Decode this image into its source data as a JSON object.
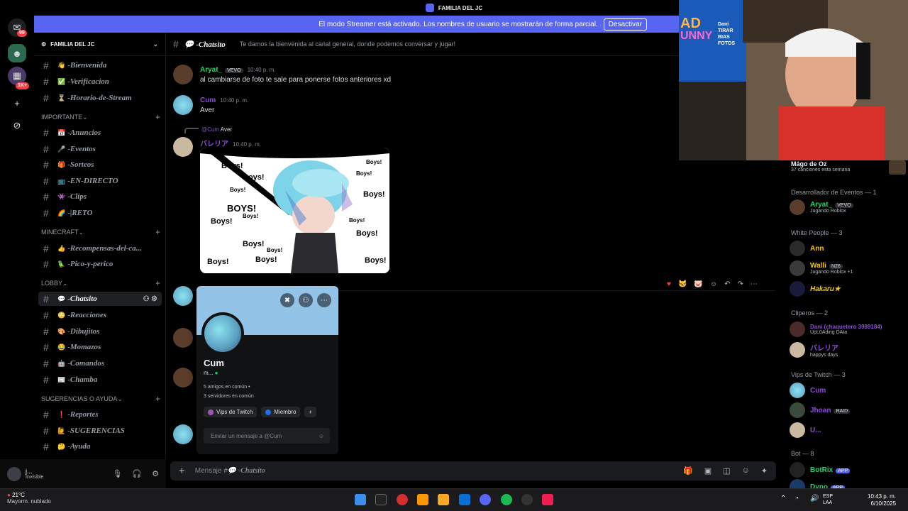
{
  "window": {
    "title": "FAMILIA DEL JC"
  },
  "rail": {
    "badge_top": "99",
    "badge_mid": "1K+"
  },
  "streamer_banner": {
    "text": "El modo Streamer está activado. Los nombres de usuario se mostrarán de forma parcial.",
    "button": "Desactivar"
  },
  "server": {
    "name": "FAMILIA DEL JC"
  },
  "channels": {
    "top": [
      {
        "emoji": "👋",
        "name": "-Bienvenida"
      },
      {
        "emoji": "✅",
        "name": "-Verificacion"
      },
      {
        "emoji": "⏳",
        "name": "-Horario-de-Stream"
      }
    ],
    "cat_importante": "IMPORTANTE",
    "importante": [
      {
        "emoji": "📅",
        "name": "-Anuncios"
      },
      {
        "emoji": "🎤",
        "name": "-Eventos"
      },
      {
        "emoji": "🎁",
        "name": "-Sorteos"
      },
      {
        "emoji": "📺",
        "name": "-EN-DIRECTO"
      },
      {
        "emoji": "👾",
        "name": "-Clips"
      },
      {
        "emoji": "🌈",
        "name": "-|RETO"
      }
    ],
    "cat_minecraft": "MINECRAFT",
    "minecraft": [
      {
        "emoji": "👍",
        "name": "-Recompensas-del-ca..."
      },
      {
        "emoji": "🦜",
        "name": "-Pico-y-perico"
      }
    ],
    "cat_lobby": "LOBBY",
    "lobby": [
      {
        "emoji": "💬",
        "name": "-Chatsito"
      },
      {
        "emoji": "😳",
        "name": "-Reacciones"
      },
      {
        "emoji": "🎨",
        "name": "-Dibujitos"
      },
      {
        "emoji": "😂",
        "name": "-Momazos"
      },
      {
        "emoji": "🤖",
        "name": "-Comandos"
      },
      {
        "emoji": "📰",
        "name": "-Chamba"
      }
    ],
    "cat_sugerencias": "SUGERENCIAS O AYUDA",
    "sugerencias": [
      {
        "emoji": "❗",
        "name": "-Reportes"
      },
      {
        "emoji": "🙋",
        "name": "-SUGERENCIAS"
      },
      {
        "emoji": "🤔",
        "name": "-Ayuda"
      }
    ]
  },
  "user": {
    "name": "j...",
    "status": "Invisible"
  },
  "chat_header": {
    "channel": "💬 -Chatsito",
    "topic": "Te damos la bienvenida al canal general, donde podemos conversar y jugar!"
  },
  "messages": [
    {
      "author": "Aryat_",
      "tag": "VEVO",
      "time": "10:40 p. m.",
      "text": "al cambiarse de foto te sale para ponerse fotos anteriores xd"
    },
    {
      "author": "Cum",
      "time": "10:40 p. m.",
      "text": "Aver"
    },
    {
      "reply_to": "@Cum",
      "reply_text": "Aver",
      "author": "バレリア",
      "time": "10:40 p. m."
    }
  ],
  "image_text": {
    "t1": "Boys!",
    "t2": "BOYS!"
  },
  "popup": {
    "name": "Cum",
    "sub": "m...",
    "mutual_friends": "5 amigos en común •",
    "mutual_servers": "3 servidores en común",
    "roles": [
      {
        "name": "Vips de Twitch",
        "color": "#9b59b6"
      },
      {
        "name": "Miembro",
        "color": "#1f6feb"
      }
    ],
    "message_placeholder": "Enviar un mensaje a @Cum"
  },
  "composer": {
    "placeholder_prefix": "Mensaje #",
    "placeholder_channel": "💬 -Chatsito"
  },
  "members": {
    "mago": {
      "name": "Mágo de Oz",
      "sub": "37 canciones esta semana"
    },
    "groups": [
      {
        "title": "Desarrollador de Eventos — 1"
      },
      {
        "title": "White People — 3"
      },
      {
        "title": "Cliperos — 2"
      },
      {
        "title": "Vips de Twitch — 3"
      },
      {
        "title": "Bot — 8"
      }
    ],
    "list": [
      {
        "name": "Aryat_",
        "tag": "VEVO",
        "activity": "Jugando Roblox",
        "color": "#2ecc71"
      },
      {
        "name": "Ann",
        "color": "#f1c40f"
      },
      {
        "name": "Walli",
        "tag": "N26",
        "activity": "Jugando Roblox +1",
        "color": "#f1c40f"
      },
      {
        "name": "Hakaru★",
        "color": "#f1c40f"
      },
      {
        "name": "Dani (chaquetero 3989184)",
        "activity": "UpL0Ading DAta",
        "color": "#9b59b6"
      },
      {
        "name": "バレリア",
        "activity": "happys days",
        "color": "#9b59b6"
      },
      {
        "name": "Cum",
        "color": "#9b59b6"
      },
      {
        "name": "Jhoan",
        "tag": "RAID",
        "color": "#9b59b6"
      },
      {
        "name": "U...",
        "color": "#9b59b6"
      },
      {
        "name": "BotRix",
        "tag": "APP",
        "color": "#2ecc71"
      },
      {
        "name": "Dyno",
        "tag": "APP",
        "color": "#2ecc71"
      }
    ]
  },
  "webcam": {
    "poster_line1": "AD",
    "poster_line2": "UNNY",
    "poster_line3": "Dani TIRAR BIAS FOTOS"
  },
  "taskbar": {
    "weather_temp": "21°C",
    "weather_desc": "Mayorm. nublado",
    "lang1": "ESP",
    "lang2": "LAA",
    "time": "10:43 p. m.",
    "date": "6/10/2025"
  },
  "colors": {
    "blurple": "#5865f2",
    "cum": "#8a4fd1",
    "aryat": "#2ecc71",
    "baleria": "#8a4fd1"
  }
}
